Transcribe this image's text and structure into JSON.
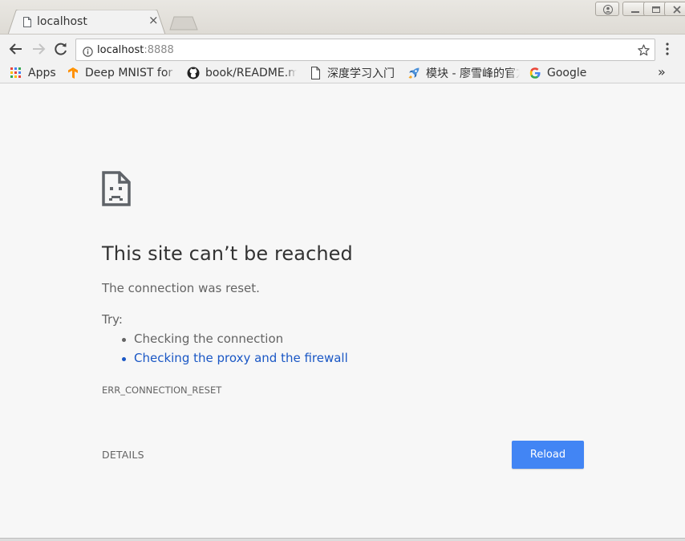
{
  "tab": {
    "title": "localhost",
    "close_glyph": "×",
    "favicon": "page-icon"
  },
  "toolbar": {
    "back_icon": "arrow-left-icon",
    "forward_icon": "arrow-right-icon",
    "reload_icon": "reload-icon",
    "url_host": "localhost",
    "url_port": ":8888",
    "star_icon": "star-icon",
    "menu_icon": "kebab-menu-icon"
  },
  "bookmarks": {
    "items": [
      {
        "label": "Apps",
        "icon": "apps-grid-icon"
      },
      {
        "label": "Deep MNIST for Experts",
        "icon": "tensorflow-icon"
      },
      {
        "label": "book/README.md",
        "icon": "github-icon"
      },
      {
        "label": "深度学习入门",
        "icon": "page-icon"
      },
      {
        "label": "模块 - 廖雪峰的官方网站",
        "icon": "rocket-icon"
      },
      {
        "label": "Google",
        "icon": "google-icon"
      }
    ],
    "overflow_glyph": "»"
  },
  "error": {
    "title": "This site can’t be reached",
    "description": "The connection was reset.",
    "try_label": "Try:",
    "suggestions": [
      {
        "text": "Checking the connection",
        "link": false
      },
      {
        "text": "Checking the proxy and the firewall",
        "link": true
      }
    ],
    "code": "ERR_CONNECTION_RESET",
    "details_label": "DETAILS",
    "reload_label": "Reload"
  },
  "colors": {
    "accent": "#4285f4",
    "link": "#1a57c5",
    "text_secondary": "#646464"
  }
}
